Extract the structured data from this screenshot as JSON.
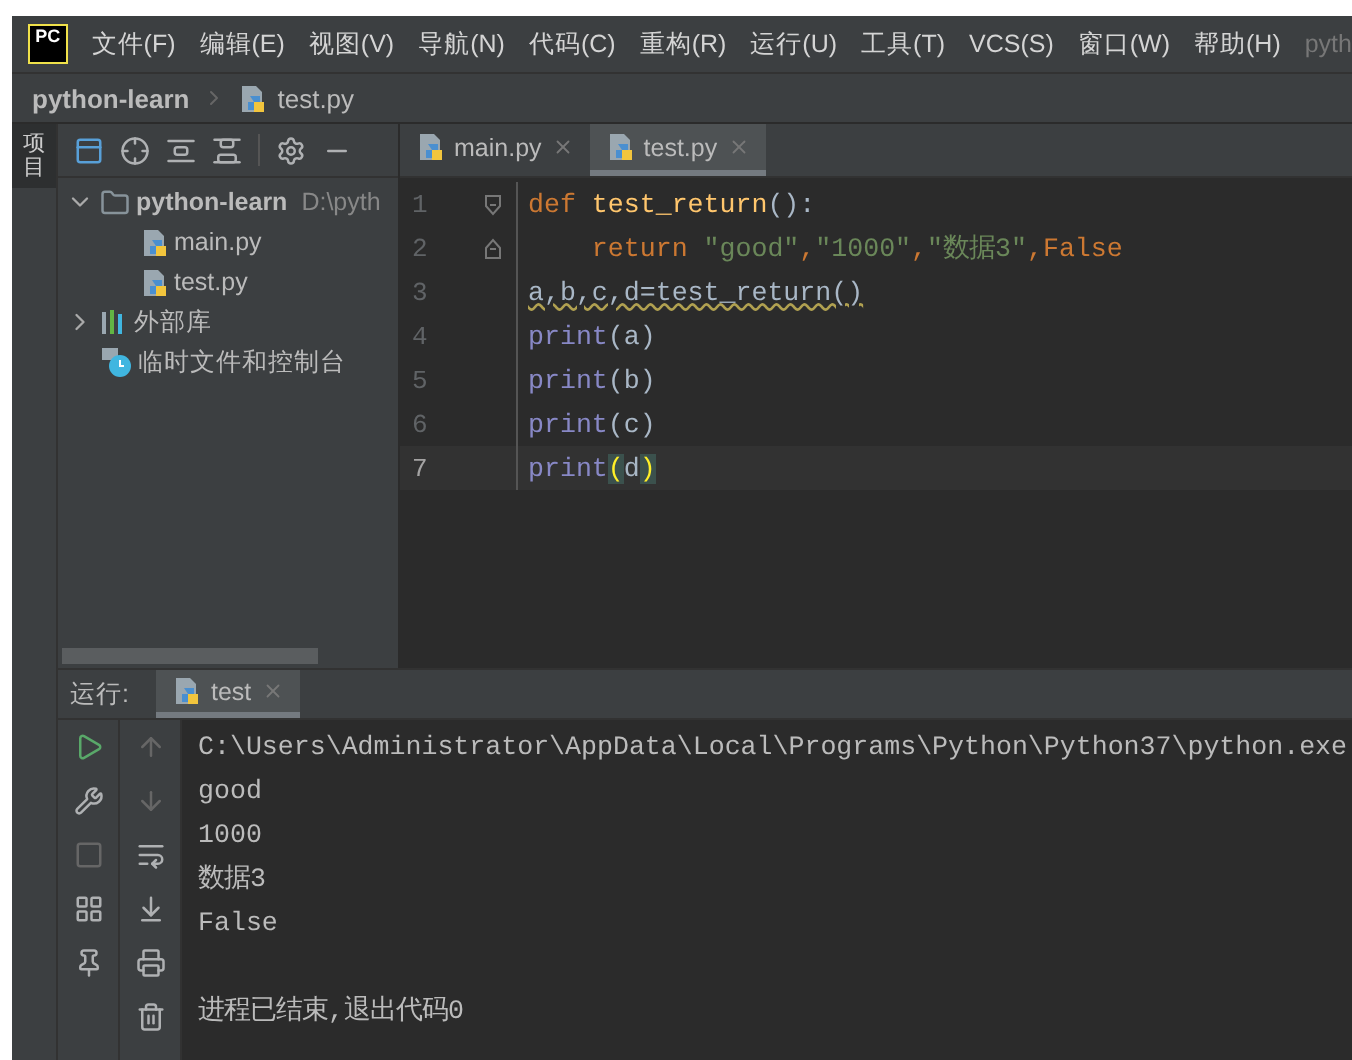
{
  "menu": {
    "items": [
      "文件(F)",
      "编辑(E)",
      "视图(V)",
      "导航(N)",
      "代码(C)",
      "重构(R)",
      "运行(U)",
      "工具(T)",
      "VCS(S)",
      "窗口(W)",
      "帮助(H)"
    ],
    "title": "pyth"
  },
  "breadcrumb": [
    "python-learn",
    "test.py"
  ],
  "side_strip": {
    "label": "项目"
  },
  "project_tree": [
    {
      "label": "python-learn",
      "path": "D:\\pyth",
      "kind": "folder",
      "expanded": true,
      "children": [
        {
          "label": "main.py",
          "kind": "python"
        },
        {
          "label": "test.py",
          "kind": "python"
        }
      ]
    },
    {
      "label": "外部库",
      "kind": "library",
      "expanded": false
    },
    {
      "label": "临时文件和控制台",
      "kind": "scratch"
    }
  ],
  "editor_tabs": [
    {
      "label": "main.py",
      "selected": false
    },
    {
      "label": "test.py",
      "selected": true
    }
  ],
  "code_lines": [
    {
      "number": "1",
      "current": false,
      "tokens": [
        {
          "text": "def ",
          "kind": "keyword"
        },
        {
          "text": "test_return",
          "kind": "function"
        },
        {
          "text": "():",
          "kind": "plain"
        }
      ]
    },
    {
      "number": "2",
      "current": false,
      "tokens": [
        {
          "text": "    return ",
          "kind": "keyword"
        },
        {
          "text": "\"good\"",
          "kind": "string"
        },
        {
          "text": ",",
          "kind": "keyword"
        },
        {
          "text": "\"1000\"",
          "kind": "string"
        },
        {
          "text": ",",
          "kind": "keyword"
        },
        {
          "text": "\"数据3\"",
          "kind": "string"
        },
        {
          "text": ",",
          "kind": "keyword"
        },
        {
          "text": "False",
          "kind": "keyword"
        }
      ]
    },
    {
      "number": "3",
      "current": false,
      "tokens": [
        {
          "text": "a,b,c,d=test_return()",
          "kind": "warning"
        }
      ]
    },
    {
      "number": "4",
      "current": false,
      "tokens": [
        {
          "text": "print",
          "kind": "builtin"
        },
        {
          "text": "(a)",
          "kind": "plain"
        }
      ]
    },
    {
      "number": "5",
      "current": false,
      "tokens": [
        {
          "text": "print",
          "kind": "builtin"
        },
        {
          "text": "(b)",
          "kind": "plain"
        }
      ]
    },
    {
      "number": "6",
      "current": false,
      "tokens": [
        {
          "text": "print",
          "kind": "builtin"
        },
        {
          "text": "(c)",
          "kind": "plain"
        }
      ]
    },
    {
      "number": "7",
      "current": true,
      "tokens": [
        {
          "text": "print",
          "kind": "builtin"
        },
        {
          "text": "(",
          "kind": "match"
        },
        {
          "text": "d",
          "kind": "plain"
        },
        {
          "text": ")",
          "kind": "match"
        }
      ]
    }
  ],
  "run_panel": {
    "label": "运行:",
    "tabs": [
      {
        "label": "test",
        "selected": true
      }
    ],
    "output": [
      "C:\\Users\\Administrator\\AppData\\Local\\Programs\\Python\\Python37\\python.exe",
      "good",
      "1000",
      "数据3",
      "False"
    ],
    "exit_message": "进程已结束,退出代码0"
  },
  "logo": "PC"
}
